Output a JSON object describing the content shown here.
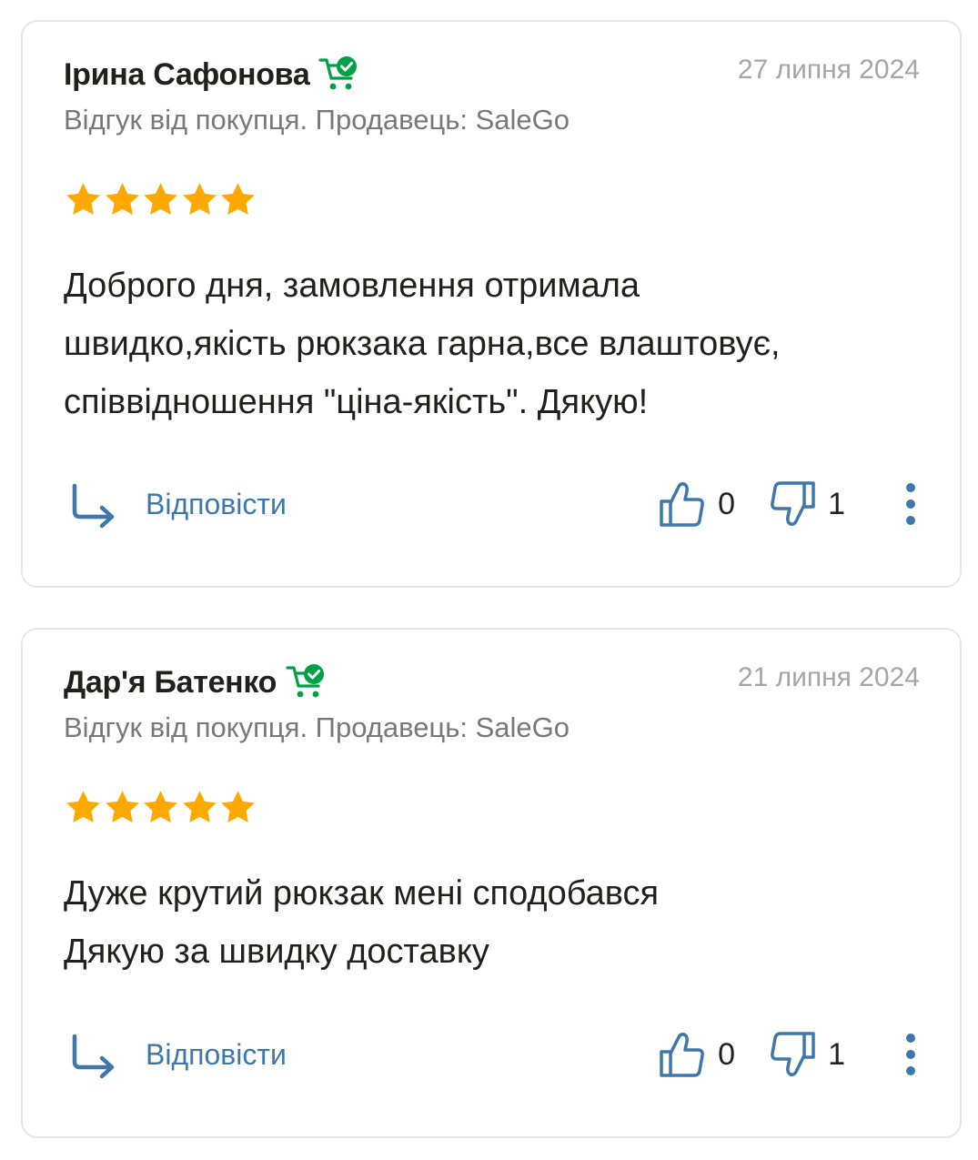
{
  "colors": {
    "link": "#3e77aa",
    "star": "#ffa900",
    "verified": "#00a046",
    "text": "#221f1f",
    "muted": "#797878",
    "date": "#a6a5a5",
    "border": "#e6e6e6"
  },
  "reviews": [
    {
      "author": "Ірина Сафонова",
      "verified_icon": "verified-buyer-cart-icon",
      "date": "27 липня 2024",
      "source": "Відгук від покупця. Продавець: SaleGo",
      "rating": 5,
      "rating_max": 5,
      "text": "Доброго дня, замовлення отримала\nшвидко,якість рюкзака гарна,все влаштовує,\nспіввідношення \"ціна-якість\". Дякую!",
      "reply_label": "Відповісти",
      "likes": "0",
      "dislikes": "1"
    },
    {
      "author": "Дар'я Батенко",
      "verified_icon": "verified-buyer-cart-icon",
      "date": "21 липня 2024",
      "source": "Відгук від покупця. Продавець: SaleGo",
      "rating": 5,
      "rating_max": 5,
      "text": "Дуже крутий рюкзак мені сподобався\nДякую за швидку доставку",
      "reply_label": "Відповісти",
      "likes": "0",
      "dislikes": "1"
    }
  ]
}
